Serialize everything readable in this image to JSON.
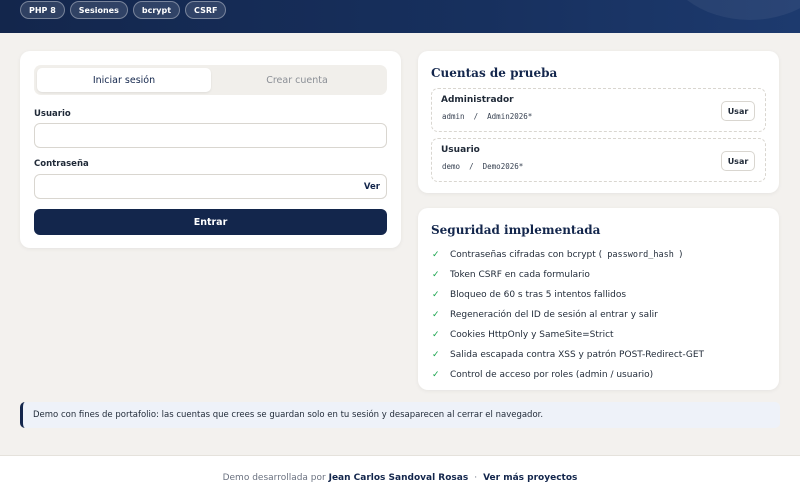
{
  "header": {
    "badges": [
      "PHP 8",
      "Sesiones",
      "bcrypt",
      "CSRF"
    ]
  },
  "login": {
    "tabs": [
      {
        "label": "Iniciar sesión",
        "active": true
      },
      {
        "label": "Crear cuenta",
        "active": false
      }
    ],
    "username_label": "Usuario",
    "username_value": "",
    "password_label": "Contraseña",
    "password_value": "",
    "show_password_label": "Ver",
    "submit_label": "Entrar"
  },
  "accounts": {
    "title": "Cuentas de prueba",
    "items": [
      {
        "role": "Administrador",
        "user": "admin",
        "separator": "/",
        "password": "Admin2026*",
        "button": "Usar"
      },
      {
        "role": "Usuario",
        "user": "demo",
        "separator": "/",
        "password": "Demo2026*",
        "button": "Usar"
      }
    ]
  },
  "security": {
    "title": "Seguridad implementada",
    "items": [
      {
        "text": "Contraseñas cifradas con bcrypt (",
        "code": " password_hash ",
        "text_after": ")"
      },
      {
        "text": "Token CSRF en cada formulario"
      },
      {
        "text": "Bloqueo de 60 s tras 5 intentos fallidos"
      },
      {
        "text": "Regeneración del ID de sesión al entrar y salir"
      },
      {
        "text": "Cookies HttpOnly y SameSite=Strict"
      },
      {
        "text": "Salida escapada contra XSS y patrón POST-Redirect-GET"
      },
      {
        "text": "Control de acceso por roles (admin / usuario)"
      }
    ],
    "check_glyph": "✓"
  },
  "notice": {
    "text": "Demo con fines de portafolio: las cuentas que crees se guardan solo en tu sesión y desaparecen al cerrar el navegador."
  },
  "footer": {
    "prefix": "Demo desarrollada por",
    "author": "Jean Carlos Sandoval Rosas",
    "separator": "·",
    "link": "Ver más proyectos"
  },
  "colors": {
    "brand": "#13264c",
    "check": "#16a34a",
    "background": "#f3f1ee"
  }
}
